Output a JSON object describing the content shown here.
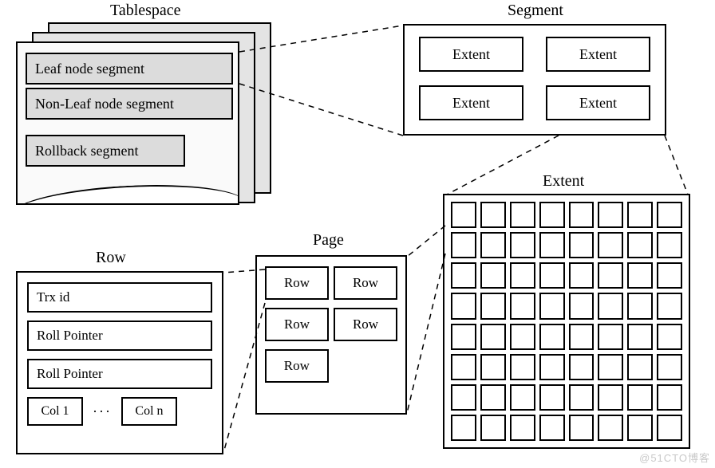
{
  "labels": {
    "tablespace": "Tablespace",
    "segment": "Segment",
    "extent": "Extent",
    "page": "Page",
    "row": "Row"
  },
  "tablespace": {
    "segments": [
      "Leaf node segment",
      "Non-Leaf node segment",
      "Rollback segment"
    ]
  },
  "segment": {
    "extent_label": "Extent",
    "extent_count": 4
  },
  "extent": {
    "grid_rows": 8,
    "grid_cols": 8
  },
  "page": {
    "row_label": "Row",
    "rows_layout": [
      2,
      2,
      1
    ]
  },
  "row": {
    "fields": [
      "Trx id",
      "Roll Pointer",
      "Roll Pointer"
    ],
    "col_first": "Col 1",
    "ellipsis": "···",
    "col_last": "Col n"
  },
  "watermark": "@51CTO博客"
}
